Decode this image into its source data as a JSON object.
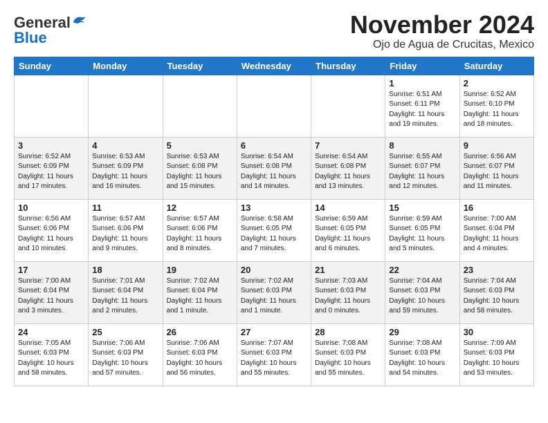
{
  "header": {
    "logo_line1": "General",
    "logo_line2": "Blue",
    "title": "November 2024",
    "subtitle": "Ojo de Agua de Crucitas, Mexico"
  },
  "weekdays": [
    "Sunday",
    "Monday",
    "Tuesday",
    "Wednesday",
    "Thursday",
    "Friday",
    "Saturday"
  ],
  "weeks": [
    [
      {
        "day": "",
        "info": ""
      },
      {
        "day": "",
        "info": ""
      },
      {
        "day": "",
        "info": ""
      },
      {
        "day": "",
        "info": ""
      },
      {
        "day": "",
        "info": ""
      },
      {
        "day": "1",
        "info": "Sunrise: 6:51 AM\nSunset: 6:11 PM\nDaylight: 11 hours\nand 19 minutes."
      },
      {
        "day": "2",
        "info": "Sunrise: 6:52 AM\nSunset: 6:10 PM\nDaylight: 11 hours\nand 18 minutes."
      }
    ],
    [
      {
        "day": "3",
        "info": "Sunrise: 6:52 AM\nSunset: 6:09 PM\nDaylight: 11 hours\nand 17 minutes."
      },
      {
        "day": "4",
        "info": "Sunrise: 6:53 AM\nSunset: 6:09 PM\nDaylight: 11 hours\nand 16 minutes."
      },
      {
        "day": "5",
        "info": "Sunrise: 6:53 AM\nSunset: 6:08 PM\nDaylight: 11 hours\nand 15 minutes."
      },
      {
        "day": "6",
        "info": "Sunrise: 6:54 AM\nSunset: 6:08 PM\nDaylight: 11 hours\nand 14 minutes."
      },
      {
        "day": "7",
        "info": "Sunrise: 6:54 AM\nSunset: 6:08 PM\nDaylight: 11 hours\nand 13 minutes."
      },
      {
        "day": "8",
        "info": "Sunrise: 6:55 AM\nSunset: 6:07 PM\nDaylight: 11 hours\nand 12 minutes."
      },
      {
        "day": "9",
        "info": "Sunrise: 6:56 AM\nSunset: 6:07 PM\nDaylight: 11 hours\nand 11 minutes."
      }
    ],
    [
      {
        "day": "10",
        "info": "Sunrise: 6:56 AM\nSunset: 6:06 PM\nDaylight: 11 hours\nand 10 minutes."
      },
      {
        "day": "11",
        "info": "Sunrise: 6:57 AM\nSunset: 6:06 PM\nDaylight: 11 hours\nand 9 minutes."
      },
      {
        "day": "12",
        "info": "Sunrise: 6:57 AM\nSunset: 6:06 PM\nDaylight: 11 hours\nand 8 minutes."
      },
      {
        "day": "13",
        "info": "Sunrise: 6:58 AM\nSunset: 6:05 PM\nDaylight: 11 hours\nand 7 minutes."
      },
      {
        "day": "14",
        "info": "Sunrise: 6:59 AM\nSunset: 6:05 PM\nDaylight: 11 hours\nand 6 minutes."
      },
      {
        "day": "15",
        "info": "Sunrise: 6:59 AM\nSunset: 6:05 PM\nDaylight: 11 hours\nand 5 minutes."
      },
      {
        "day": "16",
        "info": "Sunrise: 7:00 AM\nSunset: 6:04 PM\nDaylight: 11 hours\nand 4 minutes."
      }
    ],
    [
      {
        "day": "17",
        "info": "Sunrise: 7:00 AM\nSunset: 6:04 PM\nDaylight: 11 hours\nand 3 minutes."
      },
      {
        "day": "18",
        "info": "Sunrise: 7:01 AM\nSunset: 6:04 PM\nDaylight: 11 hours\nand 2 minutes."
      },
      {
        "day": "19",
        "info": "Sunrise: 7:02 AM\nSunset: 6:04 PM\nDaylight: 11 hours\nand 1 minute."
      },
      {
        "day": "20",
        "info": "Sunrise: 7:02 AM\nSunset: 6:03 PM\nDaylight: 11 hours\nand 1 minute."
      },
      {
        "day": "21",
        "info": "Sunrise: 7:03 AM\nSunset: 6:03 PM\nDaylight: 11 hours\nand 0 minutes."
      },
      {
        "day": "22",
        "info": "Sunrise: 7:04 AM\nSunset: 6:03 PM\nDaylight: 10 hours\nand 59 minutes."
      },
      {
        "day": "23",
        "info": "Sunrise: 7:04 AM\nSunset: 6:03 PM\nDaylight: 10 hours\nand 58 minutes."
      }
    ],
    [
      {
        "day": "24",
        "info": "Sunrise: 7:05 AM\nSunset: 6:03 PM\nDaylight: 10 hours\nand 58 minutes."
      },
      {
        "day": "25",
        "info": "Sunrise: 7:06 AM\nSunset: 6:03 PM\nDaylight: 10 hours\nand 57 minutes."
      },
      {
        "day": "26",
        "info": "Sunrise: 7:06 AM\nSunset: 6:03 PM\nDaylight: 10 hours\nand 56 minutes."
      },
      {
        "day": "27",
        "info": "Sunrise: 7:07 AM\nSunset: 6:03 PM\nDaylight: 10 hours\nand 55 minutes."
      },
      {
        "day": "28",
        "info": "Sunrise: 7:08 AM\nSunset: 6:03 PM\nDaylight: 10 hours\nand 55 minutes."
      },
      {
        "day": "29",
        "info": "Sunrise: 7:08 AM\nSunset: 6:03 PM\nDaylight: 10 hours\nand 54 minutes."
      },
      {
        "day": "30",
        "info": "Sunrise: 7:09 AM\nSunset: 6:03 PM\nDaylight: 10 hours\nand 53 minutes."
      }
    ]
  ]
}
